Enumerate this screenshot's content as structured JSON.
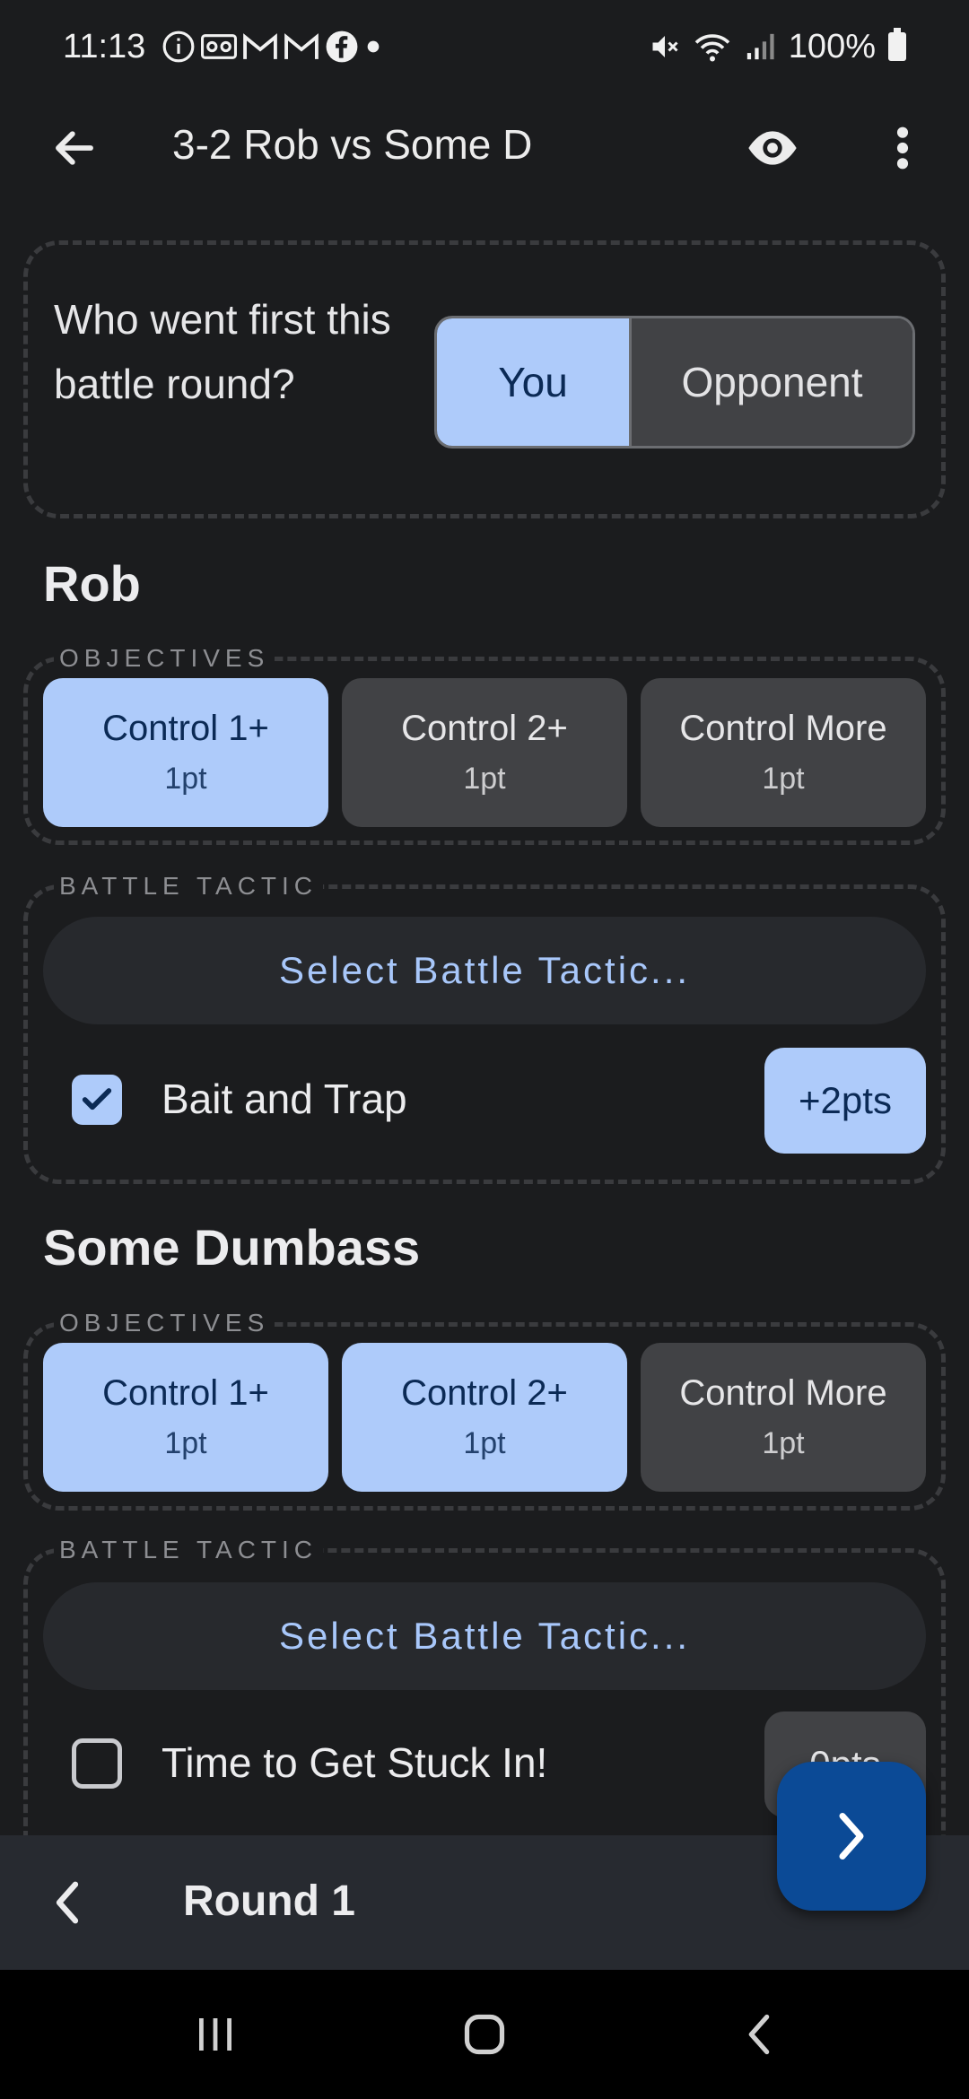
{
  "status": {
    "time": "11:13",
    "notification_icons": [
      "info-icon",
      "voicemail-icon",
      "gmail-icon",
      "gmail-icon",
      "facebook-icon",
      "dot-icon"
    ],
    "battery": "100%"
  },
  "app_bar": {
    "title": "3-2 Rob vs Some D"
  },
  "first_turn": {
    "question": "Who went first this battle round?",
    "options": [
      "You",
      "Opponent"
    ],
    "selected": "You"
  },
  "players": [
    {
      "name": "Rob",
      "objectives_label": "OBJECTIVES",
      "objectives": [
        {
          "title": "Control 1+",
          "points": "1pt",
          "selected": true
        },
        {
          "title": "Control 2+",
          "points": "1pt",
          "selected": false
        },
        {
          "title": "Control More",
          "points": "1pt",
          "selected": false
        }
      ],
      "tactic_label": "BATTLE TACTIC",
      "select_tactic": "Select Battle Tactic...",
      "tactic": {
        "name": "Bait and Trap",
        "checked": true,
        "points": "+2pts"
      }
    },
    {
      "name": "Some Dumbass",
      "objectives_label": "OBJECTIVES",
      "objectives": [
        {
          "title": "Control 1+",
          "points": "1pt",
          "selected": true
        },
        {
          "title": "Control 2+",
          "points": "1pt",
          "selected": true
        },
        {
          "title": "Control More",
          "points": "1pt",
          "selected": false
        }
      ],
      "tactic_label": "BATTLE TACTIC",
      "select_tactic": "Select Battle Tactic...",
      "tactic": {
        "name": "Time to Get Stuck In!",
        "checked": false,
        "points": "0pts"
      }
    }
  ],
  "bottom_bar": {
    "round": "Round 1"
  },
  "colors": {
    "accent": "#aecbfa",
    "background": "#1b1c1e",
    "fab": "#0b4a96"
  }
}
